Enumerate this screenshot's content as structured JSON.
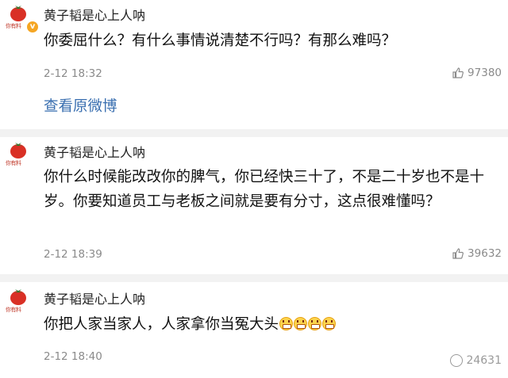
{
  "comments": [
    {
      "user": "黄子韬是心上人呐",
      "avatar_caption": "你有料",
      "text": "你委屈什么？有什么事情说清楚不行吗？有那么难吗？",
      "time": "2-12 18:32",
      "likes": "97380",
      "link": "查看原微博"
    },
    {
      "user": "黄子韬是心上人呐",
      "avatar_caption": "你有料",
      "text": "你什么时候能改改你的脾气，你已经快三十了，不是二十岁也不是十岁。你要知道员工与老板之间就是要有分寸，这点很难懂吗？",
      "time": "2-12 18:39",
      "likes": "39632"
    },
    {
      "user": "黄子韬是心上人呐",
      "avatar_caption": "你有料",
      "text": "你把人家当家人，人家拿你当冤大头",
      "time": "2-12 18:40"
    }
  ],
  "watermark": "24631",
  "colors": {
    "link": "#3a6fb0",
    "separator": "#f2f2f2",
    "badge": "#f5a623",
    "muted": "#8a8a8a"
  },
  "icons": [
    "tomato-avatar",
    "verified-badge",
    "thumbs-up-icon",
    "grin-emoji"
  ]
}
